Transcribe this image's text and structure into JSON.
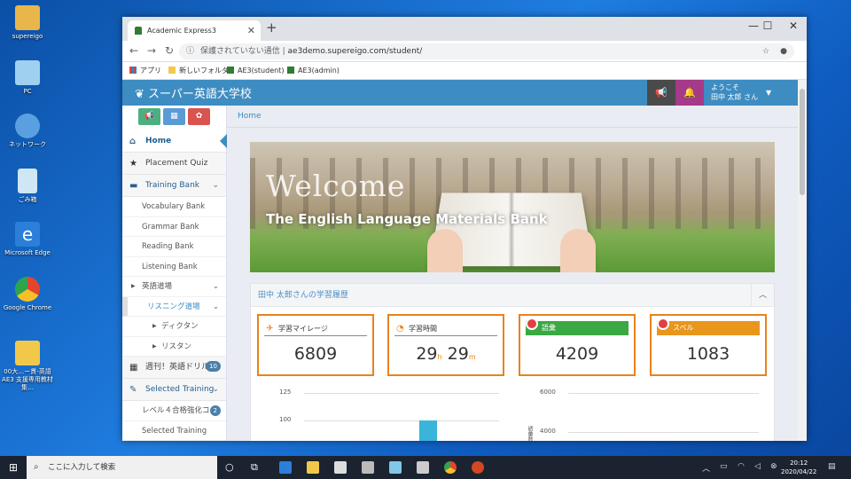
{
  "desktop": {
    "icons": [
      {
        "label": "supereigo",
        "color": "#e8b64a"
      },
      {
        "label": "PC",
        "color": "#9fd0f0"
      },
      {
        "label": "ネットワーク",
        "color": "#5aa0e0"
      },
      {
        "label": "ごみ箱",
        "color": "#cfe6f5"
      },
      {
        "label": "Microsoft Edge",
        "color": "#2b7fd8"
      },
      {
        "label": "Google Chrome",
        "color": "#e4452f"
      },
      {
        "label": "00大…ー貫-英語AE3 支援専用教材集…",
        "color": "#f2c84b"
      }
    ]
  },
  "browser": {
    "tab_title": "Academic Express3",
    "tab_close": "✕",
    "new_tab": "+",
    "win_min": "—",
    "win_max": "☐",
    "win_close": "✕",
    "nav_back": "←",
    "nav_forward": "→",
    "nav_reload": "↻",
    "security": "保護されていない通信",
    "separator": "|",
    "url": "ae3demo.supereigo.com/student/",
    "bookmarks": [
      "アプリ",
      "新しいフォルダ",
      "AE3(student)",
      "AE3(admin)"
    ]
  },
  "site": {
    "brand": "スーパー英語大学校",
    "welcome_line1": "ようこそ",
    "welcome_line2": "田中 太郎 さん",
    "breadcrumb": "Home",
    "menu": [
      {
        "label": "Home",
        "icon": "⌂"
      },
      {
        "label": "Placement Quiz",
        "icon": "★"
      },
      {
        "label": "Training Bank",
        "icon": "▬"
      }
    ],
    "training_sub": [
      "Vocabulary Bank",
      "Grammar Bank",
      "Reading Bank",
      "Listening Bank"
    ],
    "group1": "英語道場",
    "group2": "リスニング道場",
    "group2_sub": [
      "ディクタン",
      "リスタン"
    ],
    "weekly": "週刊！英語ドリル",
    "weekly_count": "10",
    "selected_training": "Selected Training",
    "level_item": "レベル４合格強化コ…",
    "level_count": "2",
    "selected_training2": "Selected Training",
    "banner_title": "Welcome",
    "banner_sub": "The English Language Materials Bank",
    "panel_title": "田中 太郎さんの学習履歴",
    "cards": [
      {
        "label": "学習マイレージ",
        "value": "6809"
      },
      {
        "label": "学習時間",
        "hours": "29",
        "h_unit": "h",
        "minutes": "29",
        "m_unit": "m"
      },
      {
        "label": "語彙",
        "value": "4209",
        "color": "#3aa843"
      },
      {
        "label": "スペル",
        "value": "1083",
        "color": "#e8961c"
      }
    ]
  },
  "chart_data": [
    {
      "type": "bar",
      "yticks": [
        125,
        100
      ],
      "bar_value": 100,
      "bar_color": "#3ab4d8",
      "xlabel": "",
      "ylabel": ""
    },
    {
      "type": "line",
      "yticks": [
        6000,
        4000
      ],
      "ylabel": "語彙数"
    }
  ],
  "taskbar": {
    "search_placeholder": "ここに入力して検索",
    "time": "20:12",
    "date": "2020/04/22"
  }
}
